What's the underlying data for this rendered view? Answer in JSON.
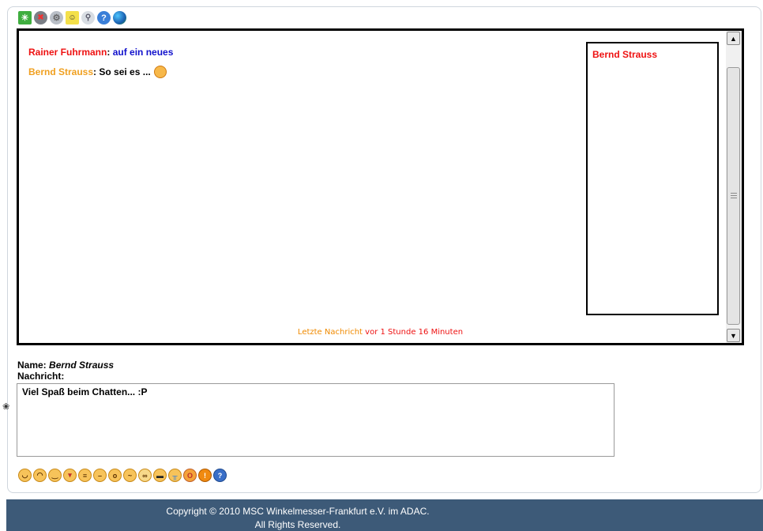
{
  "toolbar": {
    "icons": [
      "refresh-icon",
      "block-icon",
      "settings-icon",
      "emoticon-icon",
      "users-icon",
      "help-icon",
      "globe-icon"
    ]
  },
  "chat": {
    "messages": [
      {
        "user": "Rainer Fuhrmann",
        "separator": ":",
        "text": "auf ein neues"
      },
      {
        "user": "Bernd Strauss",
        "separator": ":",
        "text": "So sei es ..."
      }
    ],
    "online_users": [
      "Bernd Strauss"
    ],
    "status": {
      "prefix": "Letzte Nachricht",
      "time": "vor 1 Stunde 16 Minuten"
    }
  },
  "form": {
    "name_label": "Name:",
    "name_value": "Bernd Strauss",
    "message_label": "Nachricht:",
    "message_value": "Viel Spaß beim Chatten... :P"
  },
  "emoticons": [
    "smile",
    "sad",
    "wink",
    "tongue",
    "grin",
    "neutral",
    "surprised",
    "confused",
    "nerd",
    "cool",
    "cry",
    "shout",
    "alert",
    "help"
  ],
  "footer": {
    "line1": "Copyright © 2010 MSC Winkelmesser-Frankfurt e.V. im ADAC.",
    "line2": "All Rights Reserved."
  },
  "colors": {
    "user_red": "#ee1111",
    "user_orange": "#f0a020",
    "message_blue": "#1111cc",
    "footer_bg": "#3d5a78"
  }
}
